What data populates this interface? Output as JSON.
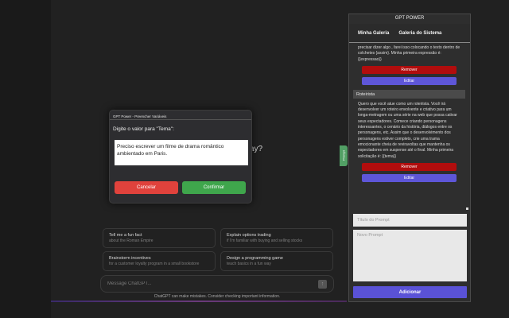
{
  "chat": {
    "question_fragment": "ay?",
    "suggestions": [
      {
        "title": "Tell me a fun fact",
        "subtitle": "about the Roman Empire"
      },
      {
        "title": "Explain options trading",
        "subtitle": "if I'm familiar with buying and selling stocks"
      },
      {
        "title": "Brainstorm incentives",
        "subtitle": "for a customer loyalty program in a small bookstore"
      },
      {
        "title": "Design a programming game",
        "subtitle": "teach basics in a fun way"
      }
    ],
    "composer_placeholder": "Message ChatGPT...",
    "disclaimer": "ChatGPT can make mistakes. Consider checking important information."
  },
  "modal": {
    "title": "GPT Power - Preencher Variáveis",
    "label": "Digite o valor para \"Tema\":",
    "input_value": "Preciso escrever um filme de drama romântico ambientado em Paris.",
    "cancel_label": "Cancelar",
    "confirm_label": "Confirmar"
  },
  "side_tab": {
    "label": "Prompt"
  },
  "panel": {
    "title": "GPT POWER",
    "tabs": [
      "Minha Galeria",
      "Galeria do Sistema"
    ],
    "prompts": [
      {
        "name": "",
        "text": "precisar dizer algo , farei isso colocando o texto dentro de colchetes {assim}. Minha primeira expressão é: {{expressao}}",
        "remove_label": "Remover",
        "edit_label": "Editar"
      },
      {
        "name": "Roteirista",
        "text": "Quero que você atue como um roteirista. Você irá desenvolver um roteiro envolvente e criativo para um longa-metragem ou uma série na web que possa cativar seus espectadores. Comece criando personagens interessantes, o cenário da história, diálogos entre os personagens, etc. Assim que o desenvolvimento dos personagens estiver completo, crie uma trama emocionante cheia de reviravoltas que mantenha os espectadores em suspense até o final. Minha primeira solicitação é: {{tema}}",
        "remove_label": "Remover",
        "edit_label": "Editar"
      }
    ],
    "title_placeholder": "Título do Prompt",
    "text_placeholder": "Novo Prompt",
    "add_label": "Adicionar"
  },
  "colors": {
    "remove": "#b10d0d",
    "edit": "#5e56d8",
    "cancel": "#e0423c",
    "confirm": "#3fa64c",
    "side_tab": "#52a065"
  }
}
